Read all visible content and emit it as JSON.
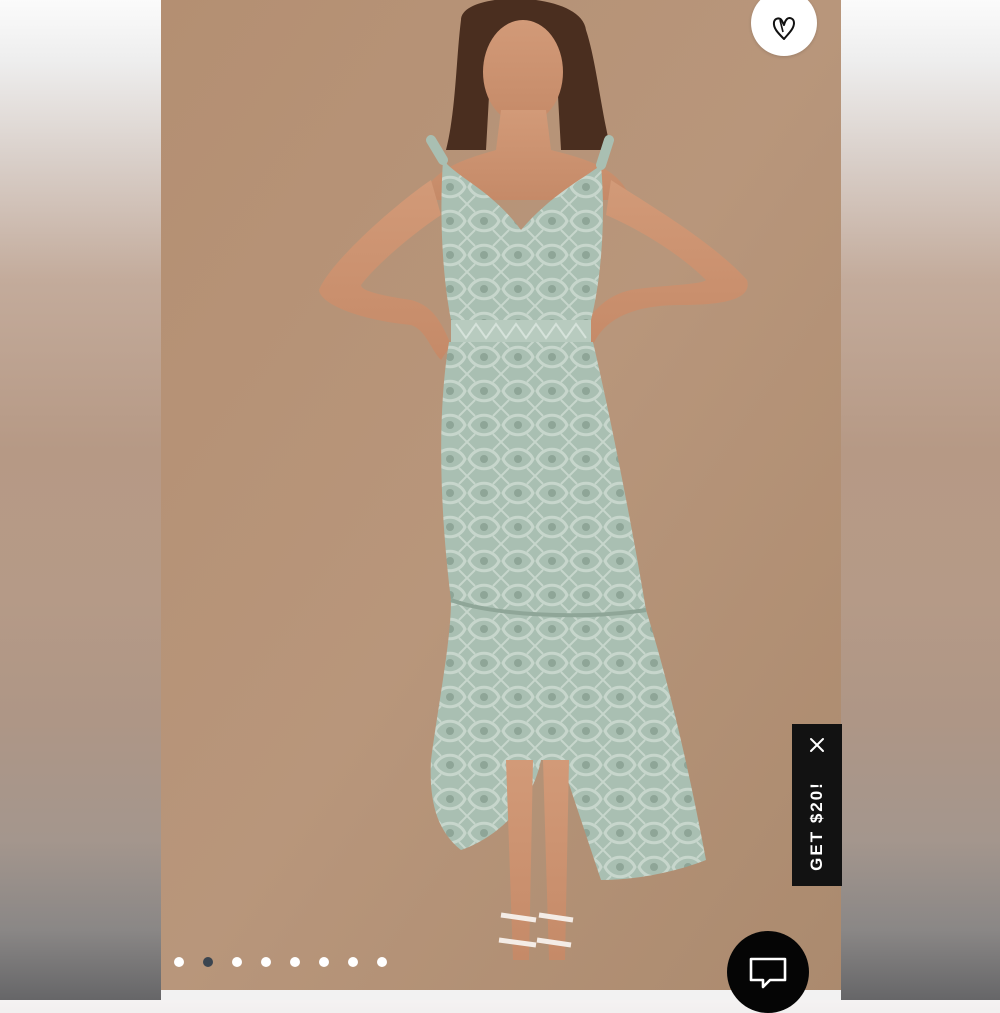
{
  "image": {
    "description_icon": "product-photo"
  },
  "favorite": {
    "icon": "heart-outline-icon"
  },
  "promo": {
    "label": "GET $20!",
    "close_icon": "close-icon"
  },
  "carousel": {
    "total": 8,
    "active_index": 1
  },
  "chat": {
    "icon": "chat-bubble-icon"
  },
  "colors": {
    "backdrop": "#b38f73",
    "dress": "#a9bfb2",
    "promo_bg": "#121212",
    "chat_bg": "#050505",
    "dot_active": "#3b4550",
    "dot_inactive": "#ffffff"
  }
}
